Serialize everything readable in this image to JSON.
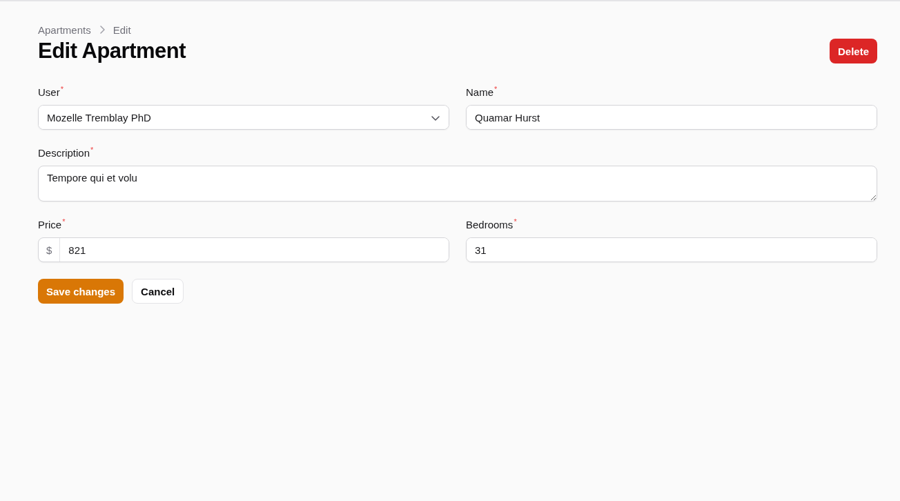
{
  "breadcrumbs": [
    {
      "label": "Apartments"
    },
    {
      "label": "Edit"
    }
  ],
  "heading": "Edit Apartment",
  "delete_button": "Delete",
  "fields": [
    {
      "kind": "select",
      "label": "User",
      "required_mark": "*",
      "value": "Mozelle Tremblay PhD"
    },
    {
      "kind": "text",
      "label": "Name",
      "required_mark": "*",
      "value": "Quamar Hurst"
    },
    {
      "kind": "textarea",
      "label": "Description",
      "required_mark": "*",
      "value": "Tempore qui et volu"
    },
    {
      "kind": "prefixed",
      "label": "Price",
      "required_mark": "*",
      "prefix": "$",
      "value": "821"
    },
    {
      "kind": "text",
      "label": "Bedrooms",
      "required_mark": "*",
      "value": "31"
    }
  ],
  "actions": [
    {
      "label": "Save changes",
      "kind": "primary"
    },
    {
      "label": "Cancel",
      "kind": "secondary"
    }
  ]
}
